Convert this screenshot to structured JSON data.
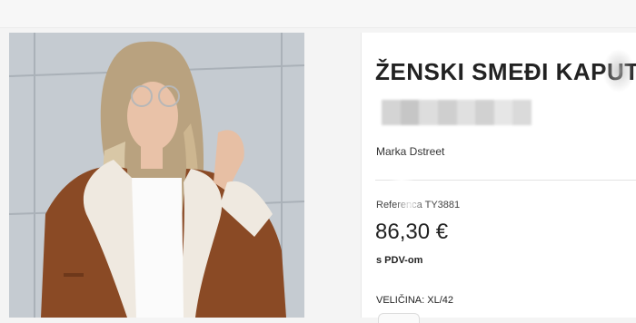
{
  "product": {
    "title": "ŽENSKI SMEĐI KAPUT",
    "brand": "Marka Dstreet",
    "reference": "Referenca TY3881",
    "price": "86,30 €",
    "tax_note": "s PDV-om",
    "size": "VELIČINA: XL/42"
  },
  "colors": {
    "background": "#f4f4f4",
    "panel": "#ffffff",
    "title": "#222222",
    "coat": "#8a4a25",
    "shearling": "#efe9e0"
  },
  "pixel_blocks": [
    "#d4d4d4",
    "#c6c6c6",
    "#dddddd",
    "#cfcfcf",
    "#e0e0e0",
    "#d1d1d1",
    "#e6e6e6",
    "#dadada"
  ]
}
